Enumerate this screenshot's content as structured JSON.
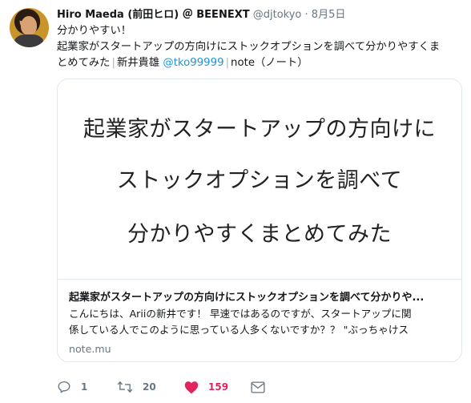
{
  "tweet": {
    "author_name": "Hiro Maeda (前田ヒロ) ＠ BEENEXT",
    "handle": "@djtokyo",
    "date_sep": "·",
    "date": "8月5日",
    "text_line1": "分かりやすい！",
    "text_line2": "起業家がスタートアップの方向けにストックオプションを調べて分かりやすくま",
    "text_line3_a": "とめてみた",
    "text_sep": "|",
    "text_line3_b": "新井貴雄",
    "mention": "@tko99999",
    "text_line3_c": "note（ノート）"
  },
  "card": {
    "image_line1": "起業家がスタートアップの方向けに",
    "image_line2": "ストックオプションを調べて",
    "image_line3": "分かりやすくまとめてみた",
    "title": "起業家がスタートアップの方向けにストックオプションを調べて分かりや...",
    "desc_line1": "こんにちは、Ariiの新井です！ 早速ではあるのですが、スタートアップに関",
    "desc_line2": "係している人でこのように思っている人多くないですか？？ \"ぶっちゃけス",
    "domain": "note.mu"
  },
  "actions": {
    "reply_count": "1",
    "retweet_count": "20",
    "like_count": "159"
  },
  "icons": {
    "reply": "reply-icon",
    "retweet": "retweet-icon",
    "like": "heart-icon",
    "dm": "direct-message-icon"
  },
  "colors": {
    "link": "#1b95e0",
    "secondary_text": "#657786",
    "like": "#e0245e"
  }
}
